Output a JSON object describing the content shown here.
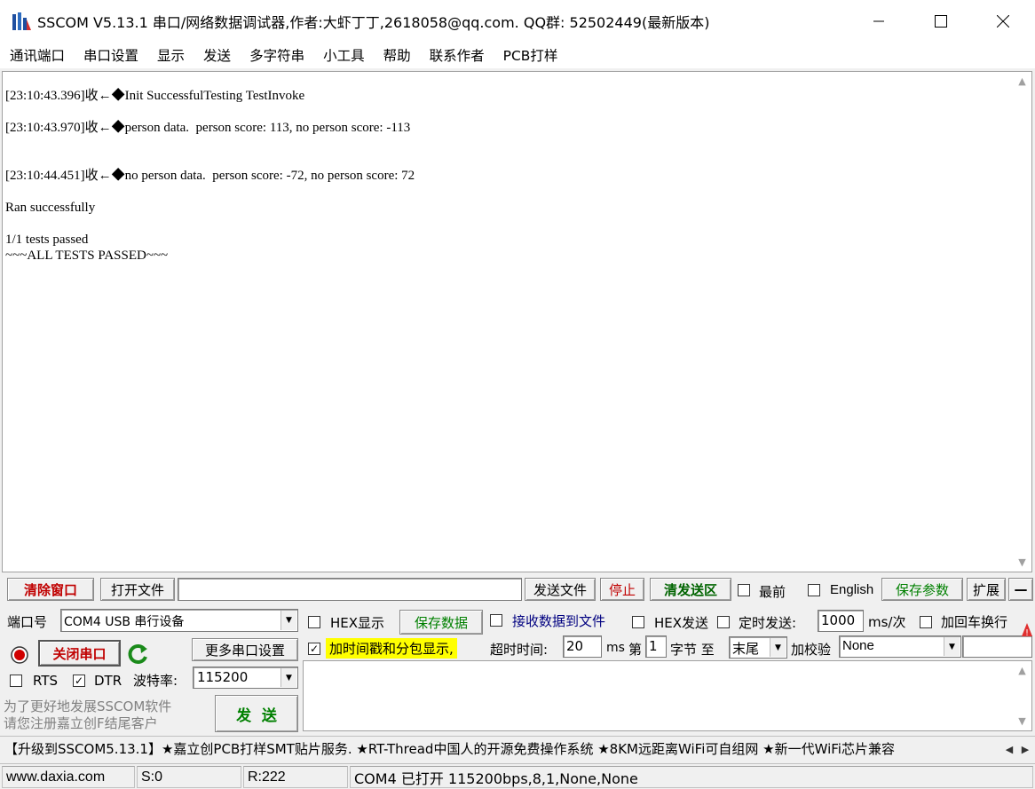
{
  "window": {
    "title": "SSCOM V5.13.1 串口/网络数据调试器,作者:大虾丁丁,2618058@qq.com. QQ群: 52502449(最新版本)",
    "min_glyph": "—",
    "max_glyph": "☐",
    "close_glyph": "✕"
  },
  "menu": [
    "通讯端口",
    "串口设置",
    "显示",
    "发送",
    "多字符串",
    "小工具",
    "帮助",
    "联系作者",
    "PCB打样"
  ],
  "receive": {
    "lines": [
      "[23:10:43.396]收←◆Init SuccessfulTesting TestInvoke",
      "",
      "[23:10:43.970]收←◆person data.  person score: 113, no person score: -113",
      "",
      "",
      "[23:10:44.451]收←◆no person data.  person score: -72, no person score: 72",
      "",
      "Ran successfully",
      "",
      "1/1 tests passed",
      "~~~ALL TESTS PASSED~~~"
    ]
  },
  "toolbar1": {
    "clear_window": "清除窗口",
    "open_file": "打开文件",
    "file_path": "",
    "send_file": "发送文件",
    "stop": "停止",
    "clear_send": "清发送区",
    "topmost_label": "最前",
    "english_label": "English",
    "save_params": "保存参数",
    "expand": "扩展",
    "collapse": "—"
  },
  "port": {
    "label": "端口号",
    "value": "COM4 USB 串行设备",
    "close_port": "关闭串口",
    "more_settings": "更多串口设置",
    "rts_label": "RTS",
    "dtr_label": "DTR",
    "rts_checked": false,
    "dtr_checked": true,
    "baud_label": "波特率:",
    "baud_value": "115200"
  },
  "options": {
    "hex_display": "HEX显示",
    "save_data": "保存数据",
    "recv_to_file": "接收数据到文件",
    "hex_send": "HEX发送",
    "timed_send": "定时发送:",
    "interval": "1000",
    "interval_unit": "ms/次",
    "add_crlf": "加回车换行",
    "timestamp": "加时间戳和分包显示,",
    "timeout_label": "超时时间:",
    "timeout_value": "20",
    "timeout_unit": "ms",
    "byte_prefix": "第",
    "byte_index": "1",
    "byte_suffix": "字节 至",
    "to_value": "末尾",
    "checksum_label": "加校验",
    "checksum_value": "None"
  },
  "promo": {
    "line1": "为了更好地发展SSCOM软件",
    "line2": "请您注册嘉立创F结尾客户",
    "send": "发  送"
  },
  "ad": "【升级到SSCOM5.13.1】★嘉立创PCB打样SMT贴片服务. ★RT-Thread中国人的开源免费操作系统 ★8KM远距离WiFi可自组网 ★新一代WiFi芯片兼容",
  "status": {
    "website": "www.daxia.com",
    "sent": "S:0",
    "received": "R:222",
    "port_status": "COM4 已打开  115200bps,8,1,None,None"
  },
  "colors": {
    "clear_window": "#c00000",
    "stop": "#c00000",
    "clear_send": "#006400",
    "save": "#008000",
    "close_port": "#c00000",
    "timestamp_bg": "#ffff00",
    "recv_to_file": "#000080"
  }
}
